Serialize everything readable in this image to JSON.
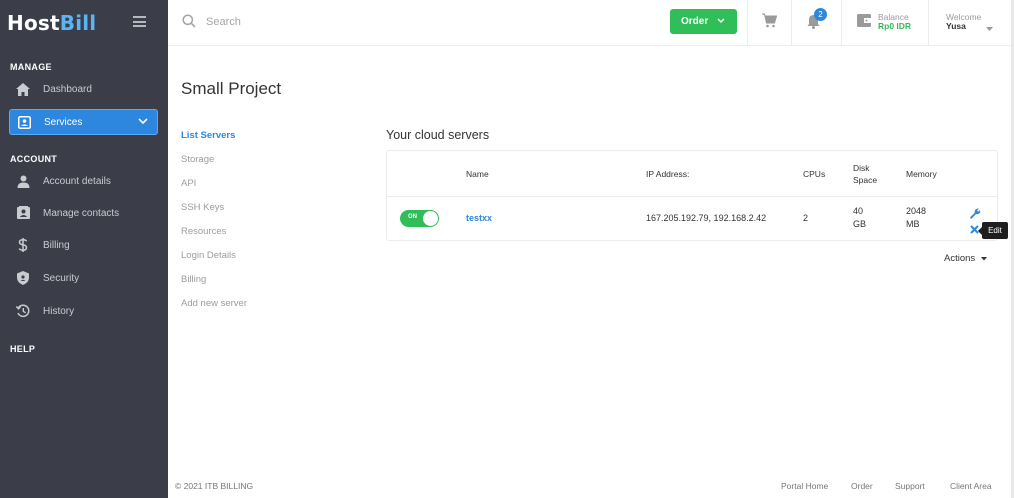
{
  "brand": {
    "part1": "Host",
    "part2": "Bill"
  },
  "sidebar": {
    "sections": {
      "manage": "MANAGE",
      "account": "ACCOUNT",
      "help": "HELP"
    },
    "items": [
      {
        "label": "Dashboard",
        "icon": "home-icon"
      },
      {
        "label": "Services",
        "icon": "services-icon",
        "active": true
      },
      {
        "label": "Account details",
        "icon": "user-icon"
      },
      {
        "label": "Manage contacts",
        "icon": "contacts-icon"
      },
      {
        "label": "Billing",
        "icon": "dollar-icon"
      },
      {
        "label": "Security",
        "icon": "shield-icon"
      },
      {
        "label": "History",
        "icon": "history-icon"
      }
    ]
  },
  "topbar": {
    "search_placeholder": "Search",
    "order_label": "Order",
    "notifications_count": "2",
    "balance_label": "Balance",
    "balance_value": "Rp0 IDR",
    "welcome_label": "Welcome",
    "user_name": "Yusa"
  },
  "page": {
    "title": "Small Project",
    "subnav": [
      "List Servers",
      "Storage",
      "API",
      "SSH Keys",
      "Resources",
      "Login Details",
      "Billing",
      "Add new server"
    ],
    "section_heading": "Your cloud servers"
  },
  "table": {
    "headers": {
      "name": "Name",
      "ip": "IP Address:",
      "cpus": "CPUs",
      "disk_line1": "Disk",
      "disk_line2": "Space",
      "memory": "Memory"
    },
    "rows": [
      {
        "toggle": "ON",
        "name": "testxx",
        "ip": "167.205.192.79, 192.168.2.42",
        "cpus": "2",
        "disk_value": "40",
        "disk_unit": "GB",
        "memory_value": "2048",
        "memory_unit": "MB"
      }
    ],
    "tooltip": "Edit",
    "actions_label": "Actions"
  },
  "footer": {
    "copyright": "© 2021 ITB BILLING",
    "links": [
      "Portal Home",
      "Order",
      "Support",
      "Client Area"
    ]
  },
  "colors": {
    "sidebar_bg": "#3b3e48",
    "accent": "#2d87df",
    "success": "#2fbe58"
  }
}
